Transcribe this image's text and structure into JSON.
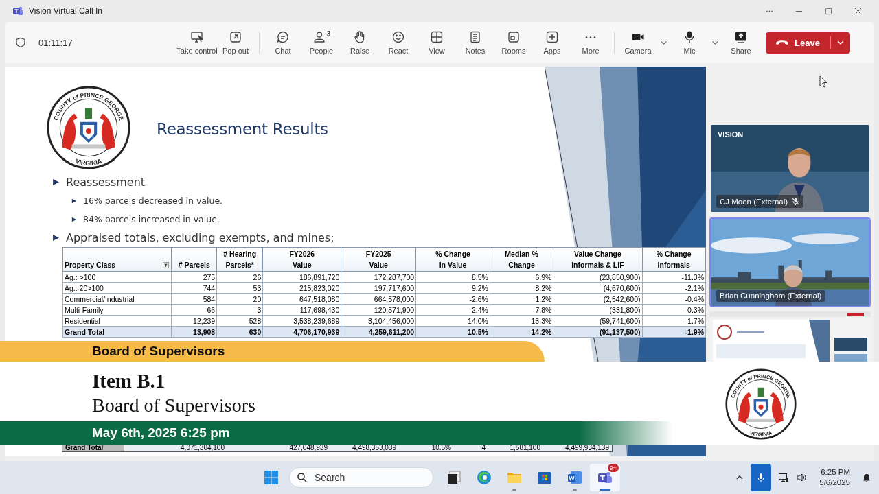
{
  "window": {
    "title": "Vision Virtual Call In"
  },
  "call_toolbar": {
    "timer": "01:11:17",
    "groups": [
      [
        {
          "kind": "take-control",
          "label": "Take control"
        },
        {
          "kind": "pop-out",
          "label": "Pop out"
        }
      ],
      [
        {
          "kind": "chat",
          "label": "Chat"
        },
        {
          "kind": "people",
          "label": "People",
          "count": "3"
        },
        {
          "kind": "raise",
          "label": "Raise"
        },
        {
          "kind": "react",
          "label": "React"
        },
        {
          "kind": "view",
          "label": "View"
        },
        {
          "kind": "notes",
          "label": "Notes"
        },
        {
          "kind": "rooms",
          "label": "Rooms"
        },
        {
          "kind": "apps",
          "label": "Apps"
        },
        {
          "kind": "more",
          "label": "More"
        }
      ],
      [
        {
          "kind": "camera",
          "label": "Camera",
          "has_menu": true
        },
        {
          "kind": "mic",
          "label": "Mic",
          "has_menu": true
        },
        {
          "kind": "share",
          "label": "Share"
        }
      ]
    ],
    "leave": "Leave"
  },
  "slide": {
    "seal": {
      "top": "COUNTY of PRINCE GEORGE",
      "bottom": "VIRGINIA"
    },
    "title": "Reassessment Results",
    "bullets": [
      {
        "text": "Reassessment",
        "children": [
          {
            "text": "16% parcels decreased in value."
          },
          {
            "text": "84% parcels increased in value."
          }
        ]
      },
      {
        "text": "Appraised totals, excluding exempts, and mines;"
      }
    ],
    "table": {
      "columns": [
        "Property Class",
        "# Parcels",
        "# Hearing\nParcels*",
        "FY2026\nValue",
        "FY2025\nValue",
        "% Change\nIn Value",
        "Median %\nChange",
        "Value Change\nInformals & LIF",
        "% Change\nInformals"
      ],
      "rows": [
        {
          "total": false,
          "cells": [
            "Ag.: >100",
            "275",
            "26",
            "186,891,720",
            "172,287,700",
            "8.5%",
            "6.9%",
            "(23,850,900)",
            "-11.3%"
          ]
        },
        {
          "total": false,
          "cells": [
            "Ag.: 20>100",
            "744",
            "53",
            "215,823,020",
            "197,717,600",
            "9.2%",
            "8.2%",
            "(4,670,600)",
            "-2.1%"
          ]
        },
        {
          "total": false,
          "cells": [
            "Commercial/Industrial",
            "584",
            "20",
            "647,518,080",
            "664,578,000",
            "-2.6%",
            "1.2%",
            "(2,542,600)",
            "-0.4%"
          ]
        },
        {
          "total": false,
          "cells": [
            "Multi-Family",
            "66",
            "3",
            "117,698,430",
            "120,571,900",
            "-2.4%",
            "7.8%",
            "(331,800)",
            "-0.3%"
          ]
        },
        {
          "total": false,
          "cells": [
            "Residential",
            "12,239",
            "528",
            "3,538,239,689",
            "3,104,456,000",
            "14.0%",
            "15.3%",
            "(59,741,600)",
            "-1.7%"
          ]
        },
        {
          "total": true,
          "cells": [
            "Grand Total",
            "13,908",
            "630",
            "4,706,170,939",
            "4,259,611,200",
            "10.5%",
            "14.2%",
            "(91,137,500)",
            "-1.9%"
          ]
        }
      ]
    },
    "lower_row": [
      "Grand Total",
      "4,071,304,100",
      "427,048,939",
      "4,498,353,039",
      "10.5%",
      "4",
      "1,581,100",
      "4,499,934,139"
    ]
  },
  "participants": [
    {
      "name": "CJ Moon (External)",
      "muted": true,
      "selected": false,
      "brand": "VISION",
      "kind": "studio"
    },
    {
      "name": "Brian Cunningham (External)",
      "muted": false,
      "selected": true,
      "kind": "skyline"
    }
  ],
  "overlay": {
    "banner": "Board of Supervisors",
    "item": "Item B.1",
    "subtitle": "Board of Supervisors",
    "date": "May 6th, 2025 6:25 pm",
    "seal": {
      "top": "COUNTY of PRINCE GEORGE",
      "bottom": "VIRGINIA"
    }
  },
  "taskbar": {
    "search": "Search",
    "apps": [
      {
        "kind": "task-view",
        "running": false,
        "active": false
      },
      {
        "kind": "edge",
        "running": false,
        "active": false
      },
      {
        "kind": "files",
        "running": true,
        "active": false
      },
      {
        "kind": "store",
        "running": false,
        "active": false
      },
      {
        "kind": "word",
        "running": true,
        "active": false
      },
      {
        "kind": "teams",
        "running": true,
        "active": true,
        "badge": "9+"
      }
    ],
    "time": "6:25 PM",
    "date": "5/6/2025"
  }
}
